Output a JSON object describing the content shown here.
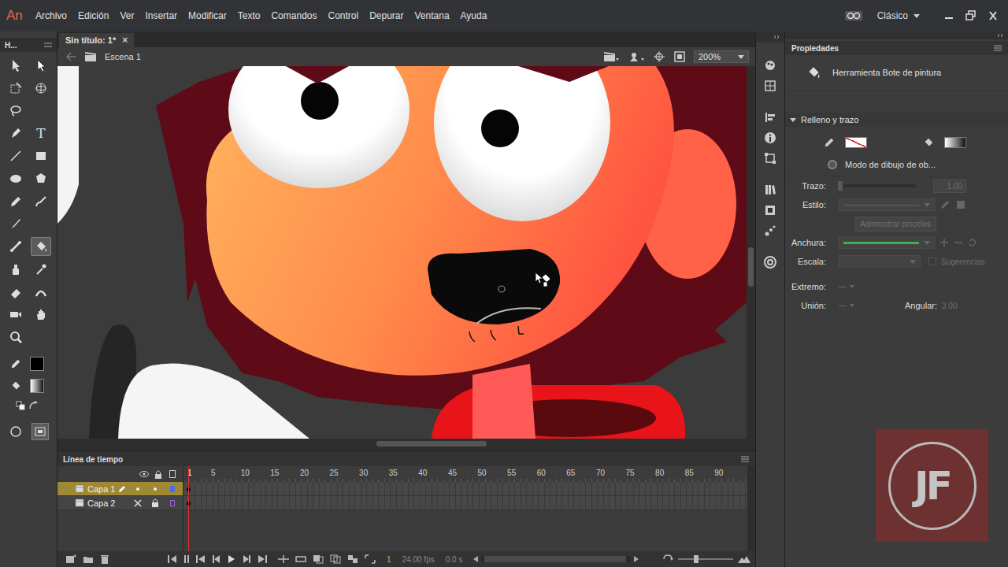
{
  "app": {
    "logo": "An",
    "menu": [
      "Archivo",
      "Edición",
      "Ver",
      "Insertar",
      "Modificar",
      "Texto",
      "Comandos",
      "Control",
      "Depurar",
      "Ventana",
      "Ayuda"
    ],
    "workspace": "Clásico"
  },
  "document_tab": {
    "title": "Sin título: 1*",
    "close": "×",
    "selected": true
  },
  "tools_panel": {
    "title": "H...",
    "tools": [
      {
        "selected": false
      },
      {
        "selected": false
      },
      {
        "selected": false
      },
      {
        "selected": false
      },
      {
        "selected": false
      },
      {
        "selected": false
      },
      {
        "selected": false,
        "glyph": "T"
      },
      {
        "selected": false
      },
      {
        "selected": false
      },
      {
        "selected": false
      },
      {
        "selected": false
      },
      {
        "selected": false
      },
      {
        "selected": false
      },
      {
        "selected": false
      },
      {
        "selected": false
      },
      {
        "selected": true
      },
      {
        "selected": false
      },
      {
        "selected": false
      },
      {
        "selected": false
      },
      {
        "selected": false
      },
      {
        "selected": false
      },
      {
        "selected": false
      },
      {
        "selected": false
      }
    ]
  },
  "edit_bar": {
    "scene": "Escena 1",
    "zoom": "200%"
  },
  "properties": {
    "title": "Propiedades",
    "tool_name": "Herramienta Bote de pintura",
    "section": {
      "label": "Relleno y trazo",
      "expanded": true
    },
    "drawing_mode": {
      "label": "Modo de dibujo de ob...",
      "on": false
    },
    "stroke": {
      "label": "Trazo:",
      "value": "1.00",
      "level": 0,
      "disabled": true
    },
    "style": {
      "label": "Estilo:",
      "disabled": true
    },
    "manage_brushes": {
      "label": "Administrar pinceles",
      "disabled": true
    },
    "width": {
      "label": "Anchura:"
    },
    "scale": {
      "label": "Escala:",
      "disabled": true
    },
    "hints": {
      "label": "Sugerencias",
      "checked": false,
      "disabled": true
    },
    "cap": {
      "label": "Extremo:"
    },
    "join": {
      "label": "Unión:"
    },
    "miter": {
      "label": "Angular:",
      "value": "3.00",
      "disabled": true
    }
  },
  "timeline": {
    "title": "Línea de tiempo",
    "ruler": [
      "1",
      "5",
      "10",
      "15",
      "20",
      "25",
      "30",
      "35",
      "40",
      "45",
      "50",
      "55",
      "60",
      "65",
      "70",
      "75",
      "80",
      "85",
      "90"
    ],
    "current_frame": "1",
    "layers": [
      {
        "name": "Capa 1",
        "selected": true,
        "visible": true,
        "locked": false,
        "editing": true,
        "keyframes": [
          "1"
        ]
      },
      {
        "name": "Capa 2",
        "selected": false,
        "visible": false,
        "locked": true,
        "editing": false,
        "keyframes": [
          "1"
        ]
      }
    ],
    "footer": {
      "frame": "1",
      "fps": "24.00 fps",
      "time": "0.0 s"
    }
  },
  "watermark": {
    "text": "JF"
  }
}
